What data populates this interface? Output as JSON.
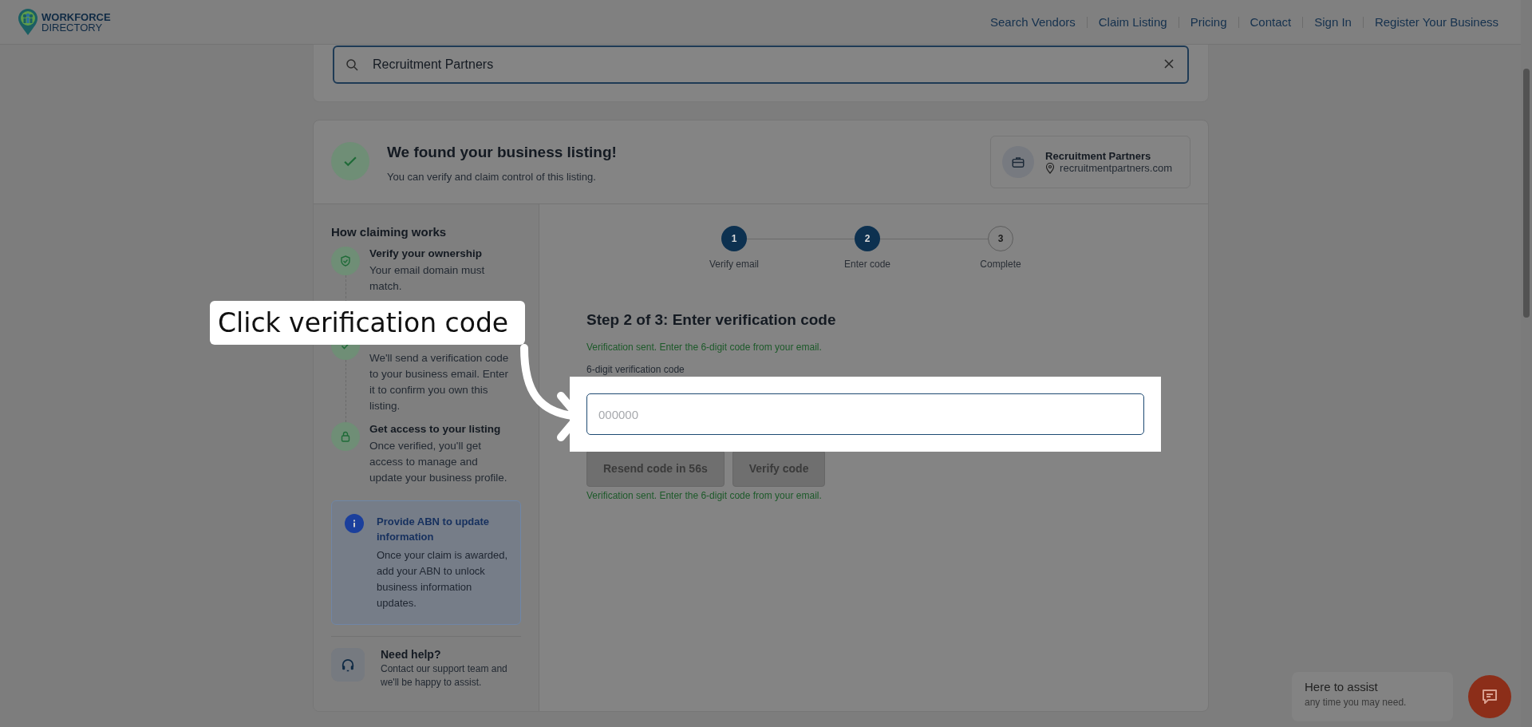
{
  "header": {
    "logo_line1": "WORKFORCE",
    "logo_line2": "DIRECTORY",
    "nav": [
      "Search Vendors",
      "Claim Listing",
      "Pricing",
      "Contact",
      "Sign In",
      "Register Your Business"
    ]
  },
  "search": {
    "value": "Recruitment Partners"
  },
  "found": {
    "title": "We found your business listing!",
    "subtitle": "You can verify and claim control of this listing.",
    "business": {
      "name": "Recruitment Partners",
      "website": "recruitmentpartners.com"
    }
  },
  "sidebar": {
    "title": "How claiming works",
    "steps": [
      {
        "kind": "shield",
        "title": "Verify your ownership",
        "text": "Your email domain must match."
      },
      {
        "kind": "check",
        "text": "We'll send a verification code to your business email. Enter it to confirm you own this listing."
      },
      {
        "kind": "lock",
        "title": "Get access to your listing",
        "text": "Once verified, you'll get access to manage and update your business profile."
      }
    ],
    "info": {
      "title": "Provide ABN to update information",
      "text": "Once your claim is awarded, add your ABN to unlock business information updates."
    },
    "help": {
      "title": "Need help?",
      "text": "Contact our support team and we'll be happy to assist."
    }
  },
  "stepper": [
    {
      "number": "1",
      "label": "Verify email",
      "filled": true
    },
    {
      "number": "2",
      "label": "Enter code",
      "filled": true
    },
    {
      "number": "3",
      "label": "Complete",
      "filled": false
    }
  ],
  "form": {
    "heading": "Step 2 of 3: Enter verification code",
    "notice": "Verification sent. Enter the 6-digit code from your email.",
    "field_label": "6-digit verification code",
    "placeholder": "000000",
    "buttons": [
      {
        "label": "Resend code in 56s",
        "disabled": true
      },
      {
        "label": "Verify code",
        "disabled": true
      }
    ],
    "status": "Verification sent. Enter the 6-digit code from your email."
  },
  "callout": {
    "text": "Click verification code"
  },
  "chat": {
    "title": "Here to assist",
    "subtitle": "any time you may need."
  }
}
